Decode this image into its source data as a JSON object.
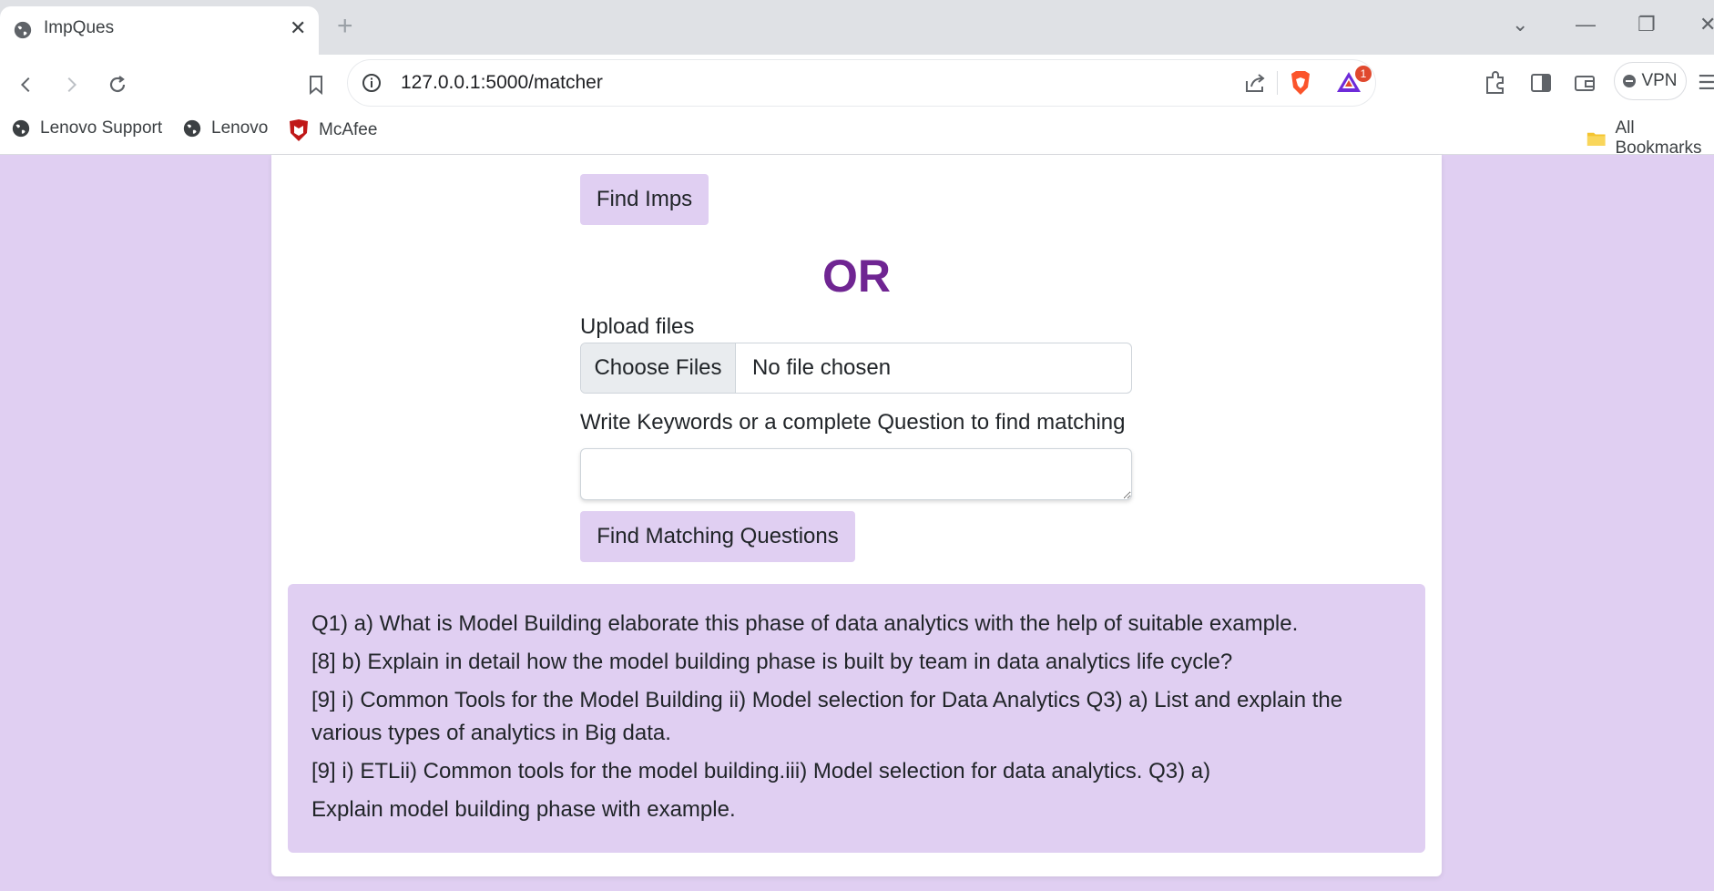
{
  "browser": {
    "tab_title": "ImpQues",
    "tab_close": "✕",
    "new_tab": "+",
    "url": "127.0.0.1:5000/matcher",
    "rewards_badge": "1",
    "vpn_label": "VPN",
    "bookmarks": [
      {
        "label": "Lenovo Support"
      },
      {
        "label": "Lenovo"
      },
      {
        "label": "McAfee"
      }
    ],
    "all_bookmarks": "All Bookmarks"
  },
  "page": {
    "find_imps_label": "Find Imps",
    "or_text": "OR",
    "upload_label": "Upload files",
    "choose_files_label": "Choose Files",
    "no_file_text": "No file chosen",
    "keywords_label": "Write Keywords or a complete Question to find matching",
    "keywords_value": "",
    "find_matching_label": "Find Matching Questions",
    "results": [
      "Q1) a) What is Model Building elaborate this phase of data analytics with the help of suitable example.",
      "[8] b) Explain in detail how the model building phase is built by team in data analytics life cycle?",
      "[9] i) Common Tools for the Model Building ii) Model selection for Data Analytics Q3) a) List and explain the various types of analytics in Big data.",
      "[9] i) ETLii) Common tools for the model building.iii) Model selection for data analytics. Q3) a)",
      "Explain model building phase with example."
    ]
  },
  "colors": {
    "page_bg": "#e0cff2",
    "accent_purple": "#6f2592",
    "button_bg": "#e0cff2"
  }
}
